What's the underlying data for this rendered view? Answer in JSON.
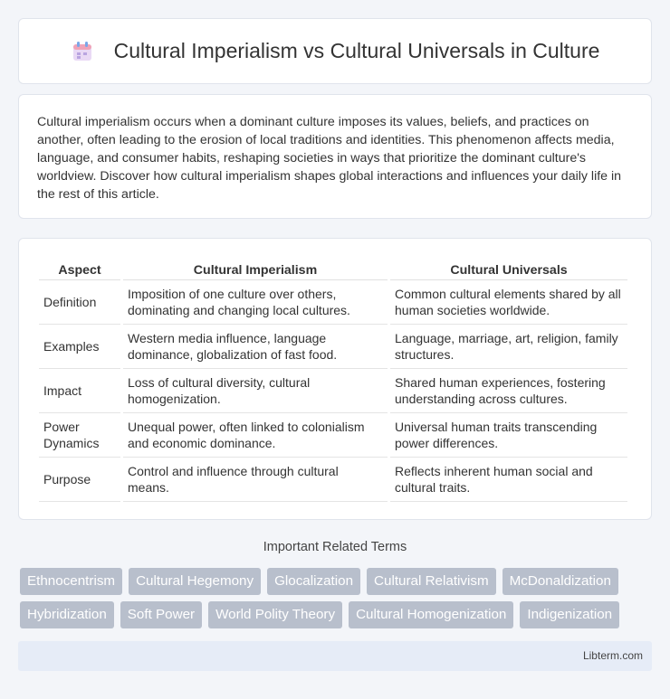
{
  "header": {
    "title": "Cultural Imperialism vs Cultural Universals in Culture",
    "icon": "calendar-icon"
  },
  "intro": {
    "text": "Cultural imperialism occurs when a dominant culture imposes its values, beliefs, and practices on another, often leading to the erosion of local traditions and identities. This phenomenon affects media, language, and consumer habits, reshaping societies in ways that prioritize the dominant culture's worldview. Discover how cultural imperialism shapes global interactions and influences your daily life in the rest of this article."
  },
  "table": {
    "headers": [
      "Aspect",
      "Cultural Imperialism",
      "Cultural Universals"
    ],
    "rows": [
      {
        "aspect": "Definition",
        "imperialism": "Imposition of one culture over others, dominating and changing local cultures.",
        "universals": "Common cultural elements shared by all human societies worldwide."
      },
      {
        "aspect": "Examples",
        "imperialism": "Western media influence, language dominance, globalization of fast food.",
        "universals": "Language, marriage, art, religion, family structures."
      },
      {
        "aspect": "Impact",
        "imperialism": "Loss of cultural diversity, cultural homogenization.",
        "universals": "Shared human experiences, fostering understanding across cultures."
      },
      {
        "aspect": "Power Dynamics",
        "imperialism": "Unequal power, often linked to colonialism and economic dominance.",
        "universals": "Universal human traits transcending power differences."
      },
      {
        "aspect": "Purpose",
        "imperialism": "Control and influence through cultural means.",
        "universals": "Reflects inherent human social and cultural traits."
      }
    ]
  },
  "related": {
    "title": "Important Related Terms",
    "row1": [
      "Ethnocentrism",
      "Cultural Hegemony",
      "Glocalization",
      "Cultural Relativism",
      "McDonaldization"
    ],
    "row2": [
      "Hybridization",
      "Soft Power",
      "World Polity Theory",
      "Cultural Homogenization",
      "Indigenization"
    ]
  },
  "footer": {
    "text": "Libterm.com"
  },
  "colors": {
    "tag_bg": "#b8bfcc",
    "footer_bg": "#e6ecf7"
  }
}
